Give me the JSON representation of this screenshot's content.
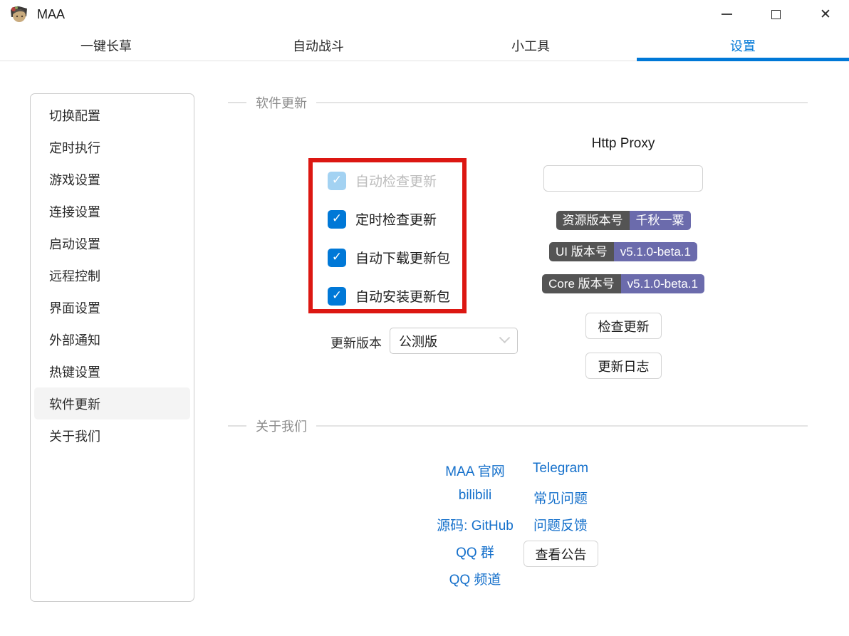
{
  "window": {
    "title": "MAA",
    "controls": {
      "minimize": "minimize",
      "maximize": "maximize",
      "close": "✕"
    }
  },
  "tabs": [
    {
      "label": "一键长草",
      "active": false
    },
    {
      "label": "自动战斗",
      "active": false
    },
    {
      "label": "小工具",
      "active": false
    },
    {
      "label": "设置",
      "active": true
    }
  ],
  "sidebar": {
    "selected": "软件更新",
    "items": [
      "切换配置",
      "定时执行",
      "游戏设置",
      "连接设置",
      "启动设置",
      "远程控制",
      "界面设置",
      "外部通知",
      "热键设置",
      "软件更新",
      "关于我们"
    ]
  },
  "sections": {
    "update": "软件更新",
    "about": "关于我们"
  },
  "update": {
    "checkboxes": [
      {
        "label": "自动检查更新",
        "checked": true,
        "disabled": true
      },
      {
        "label": "定时检查更新",
        "checked": true,
        "disabled": false
      },
      {
        "label": "自动下载更新包",
        "checked": true,
        "disabled": false
      },
      {
        "label": "自动安装更新包",
        "checked": true,
        "disabled": false
      }
    ],
    "check_glyph": "✓",
    "version_select": {
      "label": "更新版本",
      "value": "公测版"
    },
    "http_proxy_label": "Http Proxy",
    "proxy_input_value": "",
    "badges": [
      {
        "name": "资源版本号",
        "value": "千秋一粟"
      },
      {
        "name": "UI 版本号",
        "value": "v5.1.0-beta.1"
      },
      {
        "name": "Core 版本号",
        "value": "v5.1.0-beta.1"
      }
    ],
    "buttons": {
      "check": "检查更新",
      "changelog": "更新日志"
    }
  },
  "about": {
    "links_col1": [
      "MAA 官网",
      "bilibili",
      "源码: GitHub",
      "QQ 群",
      "QQ 频道"
    ],
    "links_col2": [
      "Telegram",
      "常见问题",
      "问题反馈"
    ],
    "announcement_button": "查看公告"
  },
  "colors": {
    "accent": "#0078d7",
    "link": "#1570cb",
    "annotation_red": "#dc1712",
    "badge_key_bg": "#545454",
    "badge_value_bg": "#6b6bac",
    "checkbox_disabled": "#a3d2f2"
  }
}
